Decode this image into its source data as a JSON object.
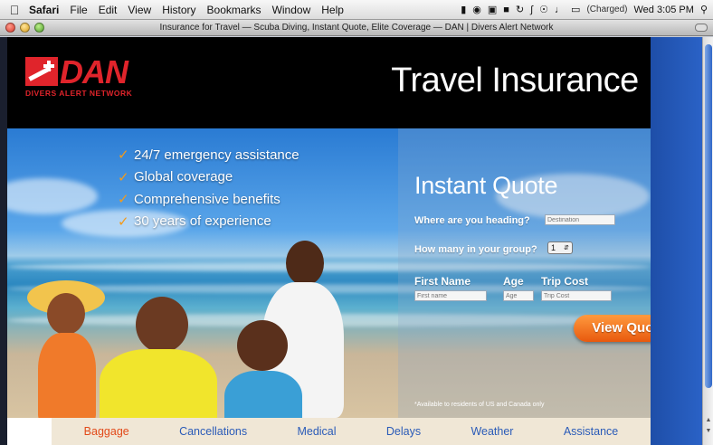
{
  "menubar": {
    "app": "Safari",
    "items": [
      "File",
      "Edit",
      "View",
      "History",
      "Bookmarks",
      "Window",
      "Help"
    ],
    "battery_status": "(Charged)",
    "clock": "Wed 3:05 PM"
  },
  "window": {
    "title": "Insurance for Travel — Scuba Diving, Instant Quote, Elite Coverage — DAN | Divers Alert Network"
  },
  "header": {
    "logo_text": "DAN",
    "logo_subtitle": "DIVERS ALERT NETWORK",
    "title": "Travel Insurance"
  },
  "hero": {
    "bullets": [
      "24/7 emergency assistance",
      "Global coverage",
      "Comprehensive benefits",
      "30 years of experience"
    ]
  },
  "quote": {
    "title": "Instant Quote",
    "destination_label": "Where are you heading?",
    "destination_placeholder": "Destination",
    "group_label": "How many in your group?",
    "group_value": "1",
    "first_name_label": "First Name",
    "first_name_placeholder": "First name",
    "age_label": "Age",
    "age_placeholder": "Age",
    "trip_cost_label": "Trip Cost",
    "trip_cost_placeholder": "Trip Cost",
    "button": "View Quote",
    "note": "*Available to residents of US and Canada only"
  },
  "nav": {
    "items": [
      "Baggage",
      "Cancellations",
      "Medical",
      "Delays",
      "Weather",
      "Assistance"
    ],
    "active": "Baggage"
  },
  "colors": {
    "brand_red": "#e0242b",
    "accent_orange": "#f08020",
    "link_blue": "#2a5bb8"
  }
}
